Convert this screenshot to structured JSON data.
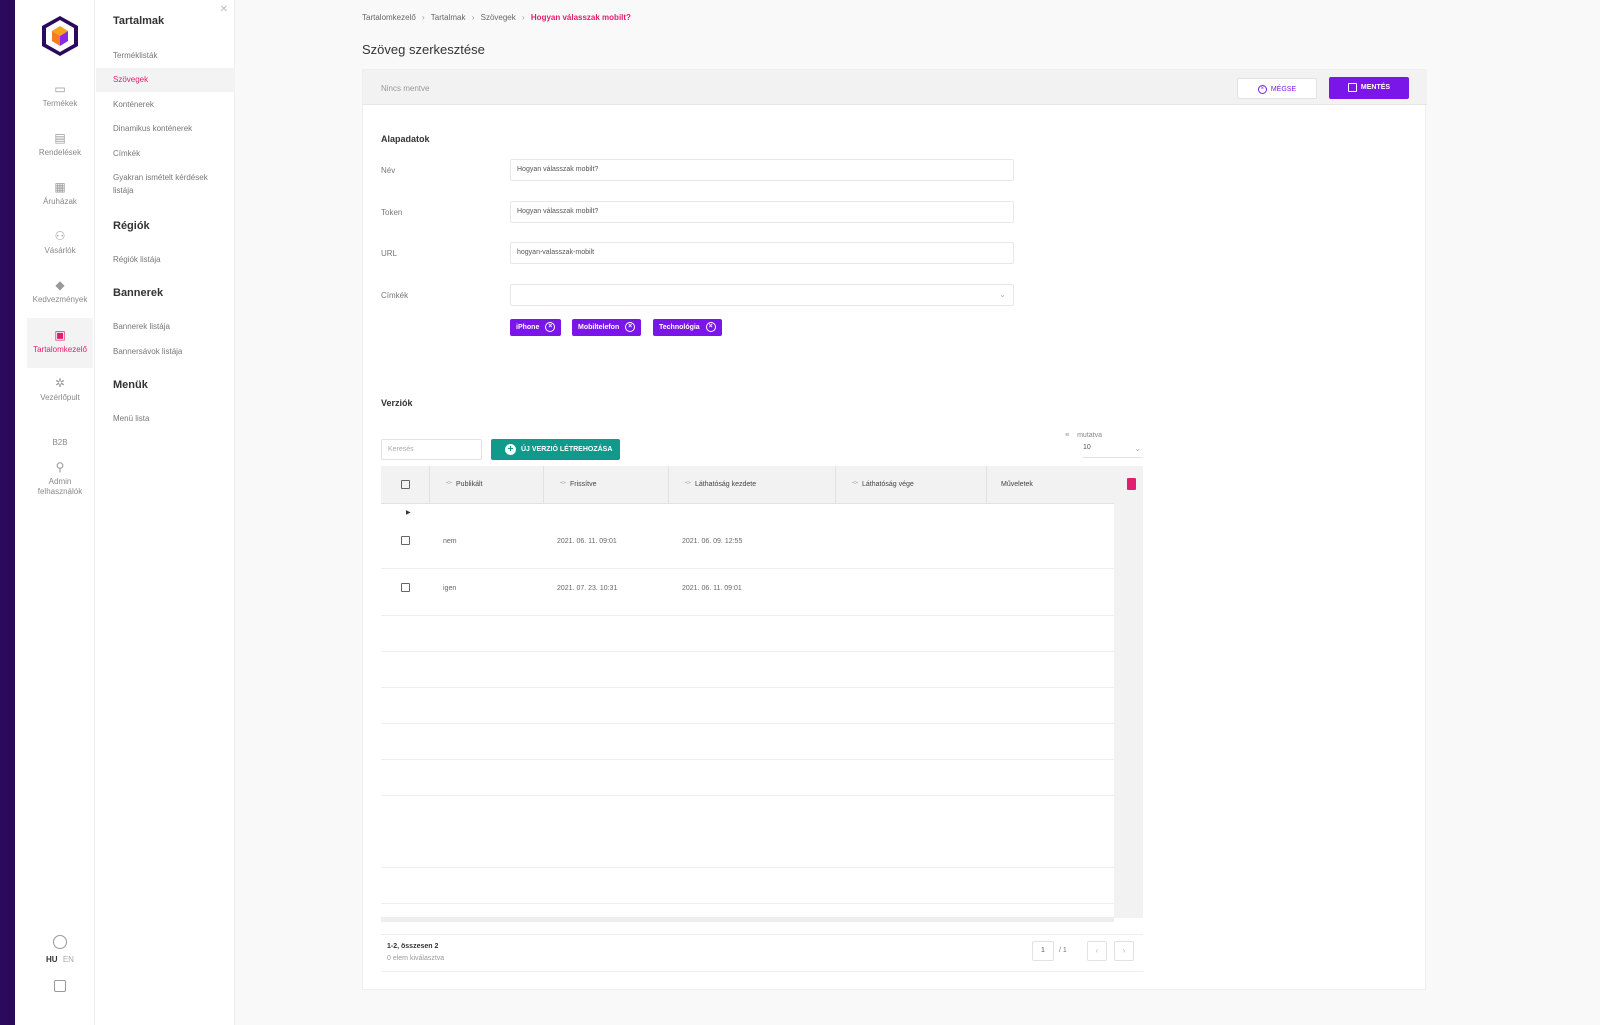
{
  "nav_rail": {
    "items": [
      {
        "label": "Termékek",
        "icon": "box-icon"
      },
      {
        "label": "Rendelések",
        "icon": "receipt-icon"
      },
      {
        "label": "Áruházak",
        "icon": "store-icon"
      },
      {
        "label": "Vásárlók",
        "icon": "users-icon"
      },
      {
        "label": "Kedvezmények",
        "icon": "tag-icon"
      },
      {
        "label": "Tartalomkezelő",
        "icon": "content-icon"
      },
      {
        "label": "Vezérlőpult",
        "icon": "gear-icon"
      }
    ],
    "b2b": "B2B",
    "admin_line1": "Admin",
    "admin_line2": "felhasználók",
    "lang_hu": "HU",
    "lang_en": "EN"
  },
  "submenu": {
    "title_tartalmak": "Tartalmak",
    "termeklistak": "Terméklisták",
    "szovegek": "Szövegek",
    "kontenerek": "Konténerek",
    "dinamikus": "Dinamikus konténerek",
    "cimkek": "Címkék",
    "gyik_line1": "Gyakran ismételt kérdések",
    "gyik_line2": "listája",
    "title_regiok": "Régiók",
    "regiok_listaja": "Régiók listája",
    "title_bannerek": "Bannerek",
    "bannerek_listaja": "Bannerek listája",
    "bannersavok_listaja": "Bannersávok listája",
    "title_menuk": "Menük",
    "menu_lista": "Menü lista"
  },
  "breadcrumb": {
    "b1": "Tartalomkezelő",
    "b2": "Tartalmak",
    "b3": "Szövegek",
    "b4": "Hogyan válasszak mobilt?",
    "sep": "›"
  },
  "page_title": "Szöveg szerkesztése",
  "toolbar": {
    "status": "Nincs mentve",
    "cancel": "MÉGSE",
    "save": "MENTÉS"
  },
  "form": {
    "section": "Alapadatok",
    "nev_label": "Név",
    "nev_value": "Hogyan válasszak mobilt?",
    "token_label": "Token",
    "token_value": "Hogyan válasszak mobilt?",
    "url_label": "URL",
    "url_value": "hogyan-valasszak-mobilt",
    "cimkek_label": "Címkék",
    "tags": [
      "iPhone",
      "Mobiltelefon",
      "Technológia"
    ]
  },
  "versions": {
    "section": "Verziók",
    "search_placeholder": "Keresés",
    "new_button": "ÚJ VERZIÓ LÉTREHOZÁSA",
    "showing_label": "mutatva",
    "per_page": "10",
    "columns": [
      "Publikált",
      "Frissítve",
      "Láthatóság kezdete",
      "Láthatóság vége",
      "Műveletek"
    ],
    "rows": [
      {
        "publikalt": "nem",
        "frissitve": "2021. 06. 11. 09:01",
        "kezdete": "2021. 06. 09. 12:55",
        "vege": ""
      },
      {
        "publikalt": "igen",
        "frissitve": "2021. 07. 23. 10:31",
        "kezdete": "2021. 06. 11. 09:01",
        "vege": ""
      }
    ],
    "count": "1-2, összesen 2",
    "selected": "0 elem kiválasztva",
    "page": "1",
    "total_pages": "/ 1"
  },
  "colors": {
    "accent": "#7b16e8",
    "pink": "#e0206e",
    "teal": "#0f9a8c",
    "dark": "#2b0a5e"
  }
}
